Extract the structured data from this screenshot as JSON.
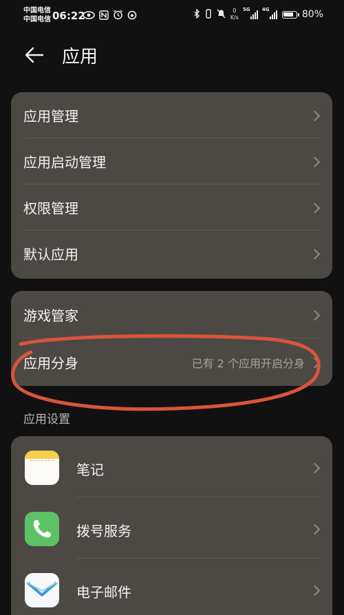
{
  "status_bar": {
    "carrier_1": "中国电信",
    "carrier_2": "中国电信",
    "time": "06:22",
    "net_speed_value": "0",
    "net_speed_unit": "K/s",
    "signal_1_label": "5G",
    "signal_2_label": "4G",
    "battery_percent": "80%",
    "battery_level": 0.8
  },
  "header": {
    "title": "应用"
  },
  "card_1": {
    "items": [
      {
        "label": "应用管理"
      },
      {
        "label": "应用启动管理"
      },
      {
        "label": "权限管理"
      },
      {
        "label": "默认应用"
      }
    ]
  },
  "card_2": {
    "items": [
      {
        "label": "游戏管家",
        "value": ""
      },
      {
        "label": "应用分身",
        "value": "已有 2 个应用开启分身"
      }
    ]
  },
  "app_settings": {
    "section_title": "应用设置",
    "apps": [
      {
        "label": "笔记",
        "icon": "notes-app-icon"
      },
      {
        "label": "拨号服务",
        "icon": "phone-app-icon"
      },
      {
        "label": "电子邮件",
        "icon": "mail-app-icon"
      }
    ]
  },
  "colors": {
    "background": "#111111",
    "card": "#4c4844",
    "annotation": "#d9553a"
  }
}
